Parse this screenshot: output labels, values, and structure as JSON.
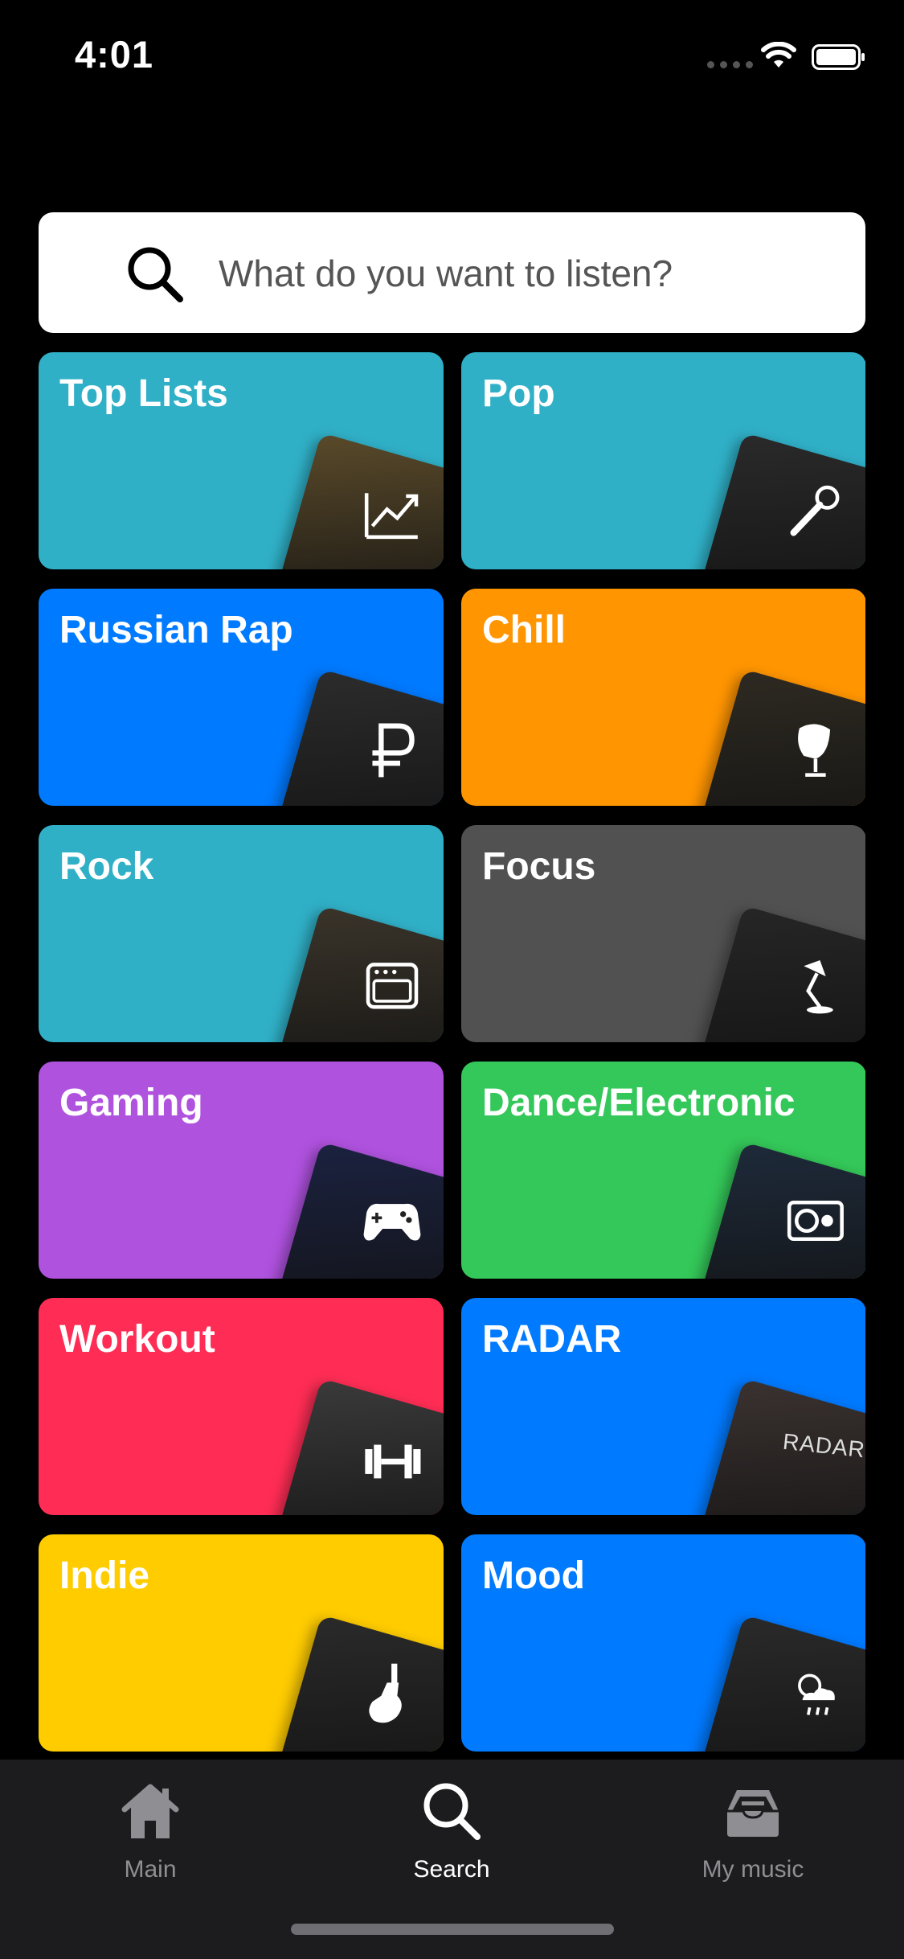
{
  "status_bar": {
    "time": "4:01"
  },
  "search": {
    "placeholder": "What do you want to listen?"
  },
  "categories": [
    {
      "label": "Top Lists",
      "color": "#30b0c7",
      "art": "chart-icon",
      "art_bg": "#5a4a2a"
    },
    {
      "label": "Pop",
      "color": "#30b0c7",
      "art": "microphone-icon",
      "art_bg": "#2a2a2a"
    },
    {
      "label": "Russian Rap",
      "color": "#007aff",
      "art": "ruble-icon",
      "art_bg": "#2c2c2c"
    },
    {
      "label": "Chill",
      "color": "#ff9500",
      "art": "egg-chair-icon",
      "art_bg": "#2e2a22"
    },
    {
      "label": "Rock",
      "color": "#30b0c7",
      "art": "amplifier-icon",
      "art_bg": "#3a342a"
    },
    {
      "label": "Focus",
      "color": "#515151",
      "art": "desk-lamp-icon",
      "art_bg": "#262626"
    },
    {
      "label": "Gaming",
      "color": "#af52de",
      "art": "gamepad-icon",
      "art_bg": "#1b2240"
    },
    {
      "label": "Dance/Electronic",
      "color": "#34c759",
      "art": "turntable-icon",
      "art_bg": "#1e2a3a"
    },
    {
      "label": "Workout",
      "color": "#ff2d55",
      "art": "dumbbell-icon",
      "art_bg": "#3a3a3a"
    },
    {
      "label": "RADAR",
      "color": "#007aff",
      "art": "radar-text",
      "art_bg": "#3a3230",
      "art_text": "RADAR"
    },
    {
      "label": "Indie",
      "color": "#ffcc00",
      "art": "guitar-icon",
      "art_bg": "#2a2a2a"
    },
    {
      "label": "Mood",
      "color": "#007aff",
      "art": "weather-icon",
      "art_bg": "#2a2a2a"
    }
  ],
  "tabs": [
    {
      "label": "Main",
      "icon": "home-icon",
      "active": false
    },
    {
      "label": "Search",
      "icon": "search-icon",
      "active": true
    },
    {
      "label": "My music",
      "icon": "library-icon",
      "active": false
    }
  ],
  "colors": {
    "background": "#000000",
    "tab_bar": "#1c1c1e",
    "inactive": "#8e8e93",
    "active": "#ffffff"
  }
}
